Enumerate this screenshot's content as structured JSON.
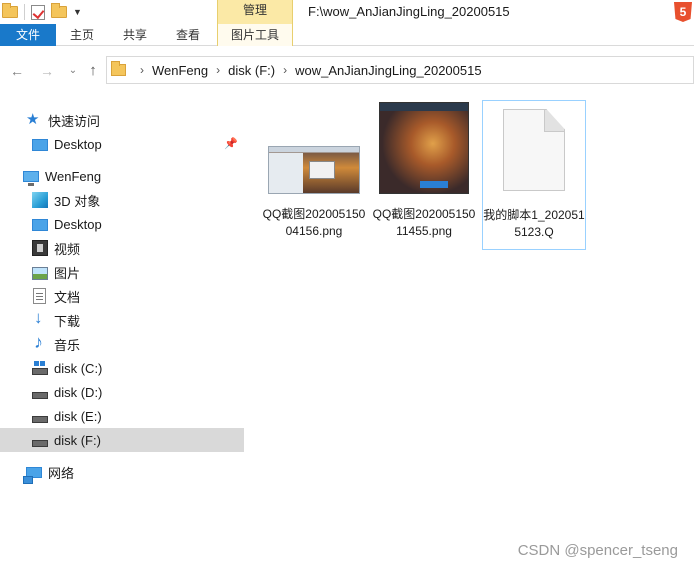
{
  "titlebar": {
    "manage_tab": "管理",
    "window_title": "F:\\wow_AnJianJingLing_20200515",
    "corner_badge": "5"
  },
  "ribbon": {
    "tabs": [
      {
        "label": "文件"
      },
      {
        "label": "主页"
      },
      {
        "label": "共享"
      },
      {
        "label": "查看"
      },
      {
        "label": "图片工具"
      }
    ]
  },
  "address": {
    "crumbs": [
      "WenFeng",
      "disk (F:)",
      "wow_AnJianJingLing_20200515"
    ]
  },
  "sidebar": {
    "items": [
      {
        "label": "快速访问",
        "icon": "star-icon"
      },
      {
        "label": "Desktop",
        "icon": "desktop-icon"
      },
      {
        "label": "WenFeng",
        "icon": "computer-icon"
      },
      {
        "label": "3D 对象",
        "icon": "3d-objects-icon"
      },
      {
        "label": "Desktop",
        "icon": "desktop-icon"
      },
      {
        "label": "视频",
        "icon": "video-icon"
      },
      {
        "label": "图片",
        "icon": "picture-icon"
      },
      {
        "label": "文档",
        "icon": "document-icon"
      },
      {
        "label": "下载",
        "icon": "download-icon"
      },
      {
        "label": "音乐",
        "icon": "music-icon"
      },
      {
        "label": "disk (C:)",
        "icon": "drive-icon"
      },
      {
        "label": "disk (D:)",
        "icon": "drive-icon"
      },
      {
        "label": "disk (E:)",
        "icon": "drive-icon"
      },
      {
        "label": "disk (F:)",
        "icon": "drive-icon"
      },
      {
        "label": "网络",
        "icon": "network-icon"
      }
    ]
  },
  "files": [
    {
      "name": "QQ截图20200515004156.png"
    },
    {
      "name": "QQ截图20200515011455.png"
    },
    {
      "name": "我的脚本1_2020515123.Q"
    }
  ],
  "watermark": "CSDN @spencer_tseng"
}
